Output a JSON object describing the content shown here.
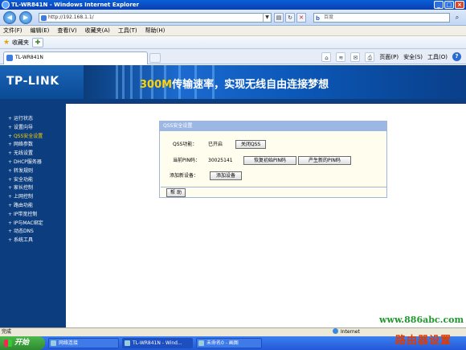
{
  "window": {
    "title": "TL-WR841N - Windows Internet Explorer",
    "controls": [
      "_",
      "□",
      "×"
    ]
  },
  "address_bar": {
    "url": "http://192.168.1.1/",
    "search_placeholder": "百度"
  },
  "menu": [
    "文件(F)",
    "编辑(E)",
    "查看(V)",
    "收藏夹(A)",
    "工具(T)",
    "帮助(H)"
  ],
  "favorites": {
    "label": "收藏夹"
  },
  "tab": {
    "title": "TL-WR841N"
  },
  "toolbar": {
    "page": "页面(P)",
    "safety": "安全(S)",
    "tools": "工具(O)"
  },
  "banner": {
    "logo": "TP-LINK",
    "slogan_highlight": "300M",
    "slogan_text": "传输速率，实现无线自由连接梦想"
  },
  "sidebar": {
    "items": [
      "运行状态",
      "设置向导",
      "QSS安全设置",
      "网络参数",
      "无线设置",
      "DHCP服务器",
      "转发规则",
      "安全功能",
      "家长控制",
      "上网控制",
      "路由功能",
      "IP带宽控制",
      "IP与MAC绑定",
      "动态DNS",
      "系统工具"
    ],
    "active_index": 2
  },
  "qss": {
    "panel_title": "QSS安全设置",
    "function_label": "QSS功能：",
    "function_status": "已开启",
    "toggle_button": "关闭QSS",
    "pin_label": "当前PIN码：",
    "pin_value": "30025141",
    "restore_pin_button": "恢复初始PIN码",
    "new_pin_button": "产生新的PIN码",
    "add_device_label": "添加新设备：",
    "add_device_button": "添加设备",
    "help_button": "帮 助"
  },
  "statusbar": {
    "text": "完成",
    "zone": "Internet"
  },
  "taskbar": {
    "start": "开始",
    "tasks": [
      "网络连接",
      "TL-WR841N - Wind...",
      "未命名0 - 画图"
    ]
  },
  "watermark": {
    "url": "www.886abc.com",
    "text": "路由器设置"
  },
  "colors": {
    "banner_blue": "#0c4f9e",
    "sidebar_blue": "#0c3e7f",
    "active_item": "#ffd200",
    "panel_header": "#9cb7e3"
  }
}
